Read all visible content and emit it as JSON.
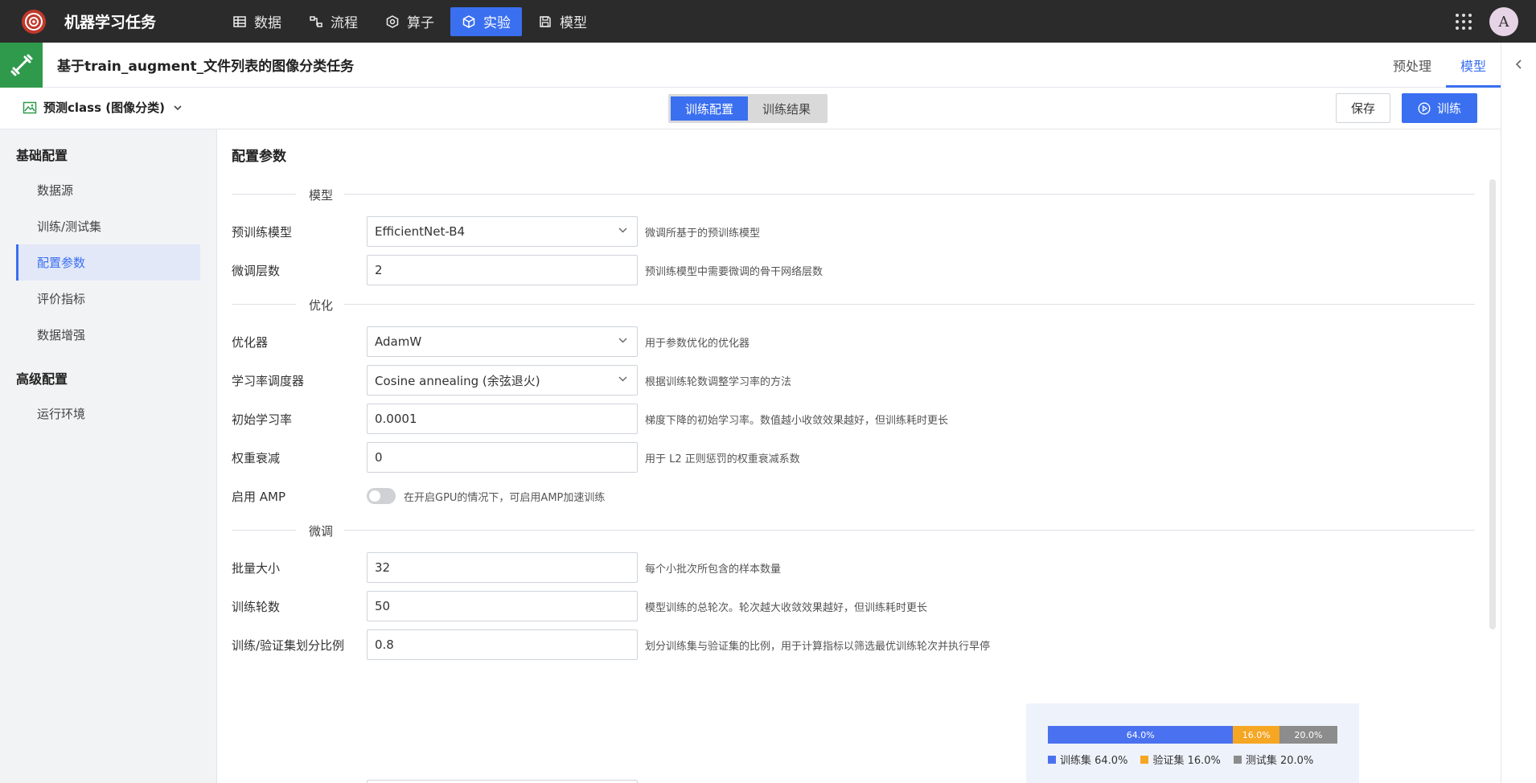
{
  "app": {
    "title": "机器学习任务",
    "avatar": "A"
  },
  "nav": [
    {
      "label": "数据",
      "icon": "table-icon"
    },
    {
      "label": "流程",
      "icon": "flow-icon"
    },
    {
      "label": "算子",
      "icon": "operator-icon"
    },
    {
      "label": "实验",
      "icon": "cube-icon",
      "active": true
    },
    {
      "label": "模型",
      "icon": "save-icon"
    }
  ],
  "task": {
    "title": "基于train_augment_文件列表的图像分类任务",
    "tabs": [
      "预处理",
      "模型"
    ],
    "active_tab": "模型"
  },
  "toolbar": {
    "model_select": "预测class (图像分类)",
    "seg": [
      "训练配置",
      "训练结果"
    ],
    "save": "保存",
    "train": "训练"
  },
  "sidebar": {
    "groups": [
      {
        "label": "基础配置",
        "items": [
          "数据源",
          "训练/测试集",
          "配置参数",
          "评价指标",
          "数据增强"
        ]
      },
      {
        "label": "高级配置",
        "items": [
          "运行环境"
        ]
      }
    ],
    "active": "配置参数"
  },
  "main": {
    "title": "配置参数",
    "sections": {
      "model": "模型",
      "optim": "优化",
      "finetune": "微调"
    },
    "fields": {
      "pretrained": {
        "label": "预训练模型",
        "value": "EfficientNet-B4",
        "hint": "微调所基于的预训练模型"
      },
      "ft_layers": {
        "label": "微调层数",
        "value": "2",
        "hint": "预训练模型中需要微调的骨干网络层数"
      },
      "optimizer": {
        "label": "优化器",
        "value": "AdamW",
        "hint": "用于参数优化的优化器"
      },
      "scheduler": {
        "label": "学习率调度器",
        "value": "Cosine annealing (余弦退火)",
        "hint": "根据训练轮数调整学习率的方法"
      },
      "lr": {
        "label": "初始学习率",
        "value": "0.0001",
        "hint": "梯度下降的初始学习率。数值越小收敛效果越好，但训练耗时更长"
      },
      "wd": {
        "label": "权重衰减",
        "value": "0",
        "hint": "用于 L2 正则惩罚的权重衰减系数"
      },
      "amp": {
        "label": "启用 AMP",
        "hint": "在开启GPU的情况下，可启用AMP加速训练"
      },
      "batch": {
        "label": "批量大小",
        "value": "32",
        "hint": "每个小批次所包含的样本数量"
      },
      "epochs": {
        "label": "训练轮数",
        "value": "50",
        "hint": "模型训练的总轮次。轮次越大收敛效果越好，但训练耗时更长"
      },
      "split": {
        "label": "训练/验证集划分比例",
        "value": "0.8",
        "hint": "划分训练集与验证集的比例，用于计算指标以筛选最优训练轮次并执行早停"
      }
    }
  },
  "split_chart": {
    "segments": [
      {
        "name": "训练集",
        "pct": 64.0,
        "label": "64.0%",
        "color": "#4a72f0"
      },
      {
        "name": "验证集",
        "pct": 16.0,
        "label": "16.0%",
        "color": "#f5a623"
      },
      {
        "name": "测试集",
        "pct": 20.0,
        "label": "20.0%",
        "color": "#8c8c8c"
      }
    ]
  },
  "colors": {
    "accent": "#3a6ff0",
    "topbar": "#2b2b2b",
    "task_icon_bg": "#2f9a4c"
  }
}
